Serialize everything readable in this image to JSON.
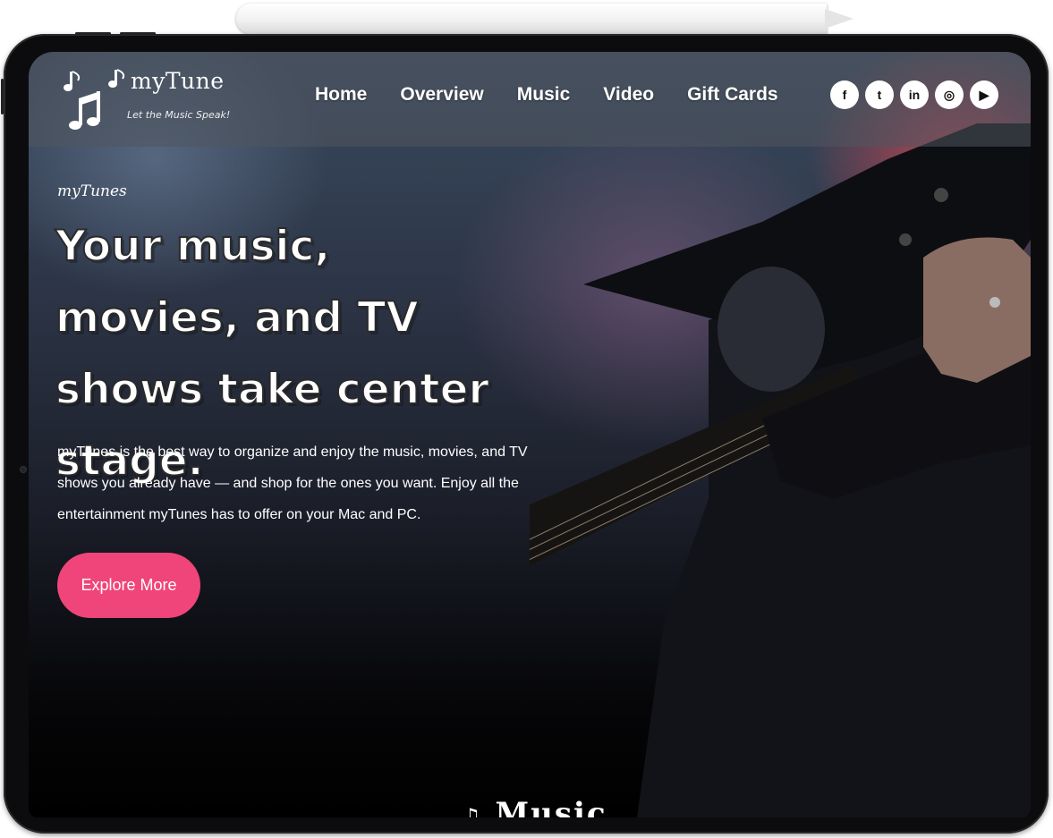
{
  "brand": {
    "name": "myTune",
    "tagline": "Let the Music Speak!"
  },
  "nav": {
    "items": [
      "Home",
      "Overview",
      "Music",
      "Video",
      "Gift Cards"
    ]
  },
  "social": {
    "icons": [
      {
        "name": "facebook-icon",
        "glyph": "f"
      },
      {
        "name": "twitter-icon",
        "glyph": "t"
      },
      {
        "name": "linkedin-icon",
        "glyph": "in"
      },
      {
        "name": "instagram-icon",
        "glyph": "◎"
      },
      {
        "name": "youtube-icon",
        "glyph": "▶"
      }
    ]
  },
  "hero": {
    "eyebrow": "myTunes",
    "headline": "Your music, movies, and TV shows take center stage.",
    "description": "myTunes is the best way to organize and enjoy the music, movies, and TV shows you already have — and shop for the ones you want. Enjoy all the entertainment myTunes has to offer on your Mac and PC.",
    "cta_label": "Explore More",
    "cta_color": "#f0457a"
  },
  "next_section": {
    "title": "Music"
  }
}
